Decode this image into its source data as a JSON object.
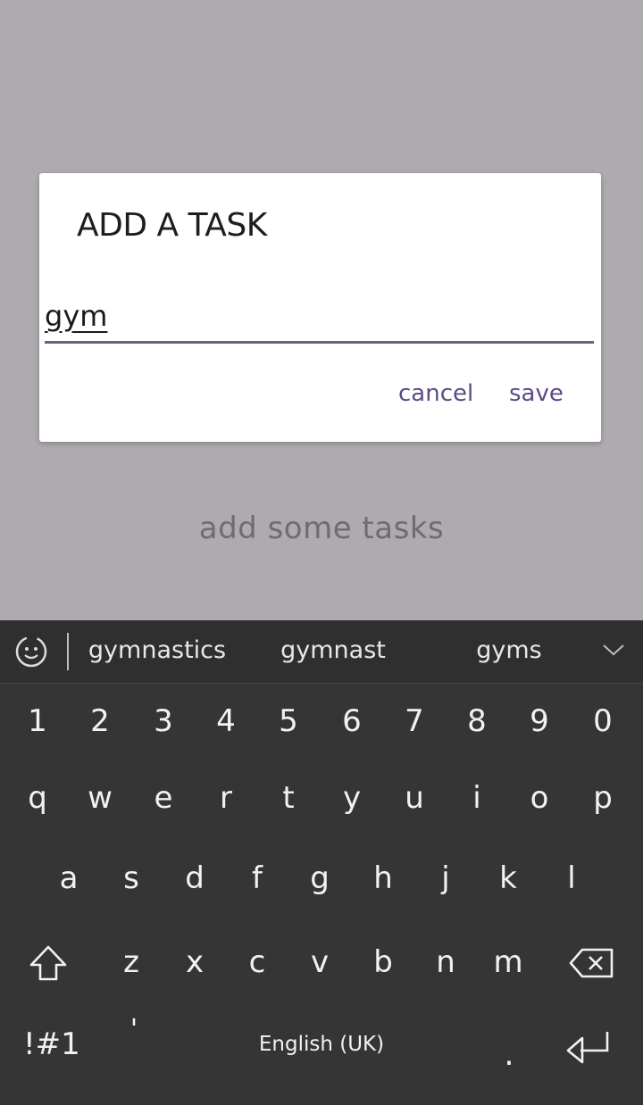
{
  "main": {
    "empty_hint": "add some tasks"
  },
  "dialog": {
    "title": "ADD A TASK",
    "input_value": "gym",
    "cancel_label": "cancel",
    "save_label": "save"
  },
  "keyboard": {
    "suggestions": [
      "gymnastics",
      "gymnast",
      "gyms"
    ],
    "number_row": [
      "1",
      "2",
      "3",
      "4",
      "5",
      "6",
      "7",
      "8",
      "9",
      "0"
    ],
    "row_1": [
      "q",
      "w",
      "e",
      "r",
      "t",
      "y",
      "u",
      "i",
      "o",
      "p"
    ],
    "row_2": [
      "a",
      "s",
      "d",
      "f",
      "g",
      "h",
      "j",
      "k",
      "l"
    ],
    "row_3": [
      "z",
      "x",
      "c",
      "v",
      "b",
      "n",
      "m"
    ],
    "symbols_label": "!#1",
    "apostrophe_label": "'",
    "space_label": "English (UK)",
    "period_label": "."
  },
  "colors": {
    "scrim_background": "#aeaaaf",
    "dialog_accent": "#5b4a86",
    "keyboard_background": "#353535"
  },
  "icons": {
    "emoji_toggle": "emoji-switch-icon",
    "collapse": "chevron-down-icon",
    "shift": "shift-arrow-icon",
    "backspace": "backspace-icon",
    "enter": "enter-icon"
  }
}
